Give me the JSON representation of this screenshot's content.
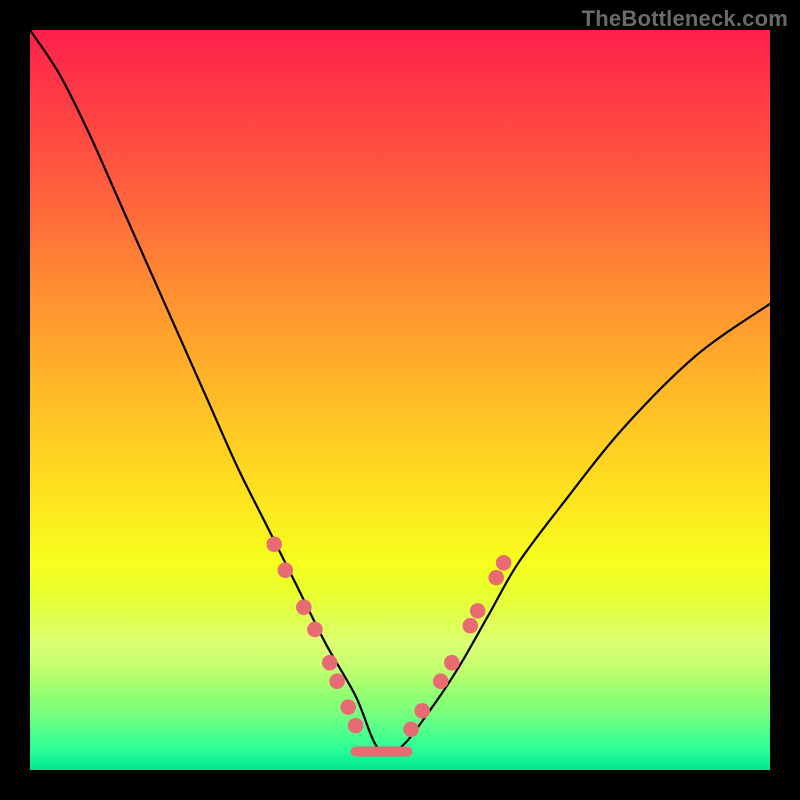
{
  "watermark": "TheBottleneck.com",
  "colors": {
    "frame": "#000000",
    "curve": "#000000",
    "bead": "#e86a73",
    "trough": "#e86a73",
    "gradient_stops": [
      {
        "pct": 0,
        "hex": "#ff1f4a"
      },
      {
        "pct": 6,
        "hex": "#ff3247"
      },
      {
        "pct": 20,
        "hex": "#ff5a3e"
      },
      {
        "pct": 34,
        "hex": "#ff8a33"
      },
      {
        "pct": 48,
        "hex": "#ffb728"
      },
      {
        "pct": 62,
        "hex": "#ffe01e"
      },
      {
        "pct": 72,
        "hex": "#f7ff1e"
      },
      {
        "pct": 80,
        "hex": "#d9ff3a"
      },
      {
        "pct": 86,
        "hex": "#b6ff5c"
      },
      {
        "pct": 92,
        "hex": "#7cff7c"
      },
      {
        "pct": 97,
        "hex": "#2dff97"
      },
      {
        "pct": 100,
        "hex": "#00e88f"
      }
    ]
  },
  "chart_data": {
    "type": "line",
    "title": "",
    "xlabel": "",
    "ylabel": "",
    "x_range": [
      0,
      100
    ],
    "y_range": [
      0,
      100
    ],
    "note": "Axes unlabeled; values are percent of plot area. y=100 at top, y=0 at bottom. Background encodes bottleneck severity by vertical position (red=high, green=low). Black line is bottleneck curve with minimum near x≈47. Coral beads/trough highlight near-zero-bottleneck region.",
    "series": [
      {
        "name": "bottleneck-curve",
        "x": [
          0,
          4,
          8,
          12,
          16,
          20,
          24,
          28,
          32,
          36,
          40,
          44,
          47,
          50,
          54,
          58,
          62,
          66,
          72,
          80,
          90,
          100
        ],
        "y": [
          100,
          94,
          86,
          77,
          68,
          59,
          50,
          41,
          33,
          25,
          17,
          10,
          3,
          3,
          8,
          14,
          21,
          28,
          36,
          46,
          56,
          63
        ]
      }
    ],
    "trough_segment": {
      "x_start": 44,
      "x_end": 51,
      "y": 2.5
    },
    "beads": [
      {
        "x": 33.0,
        "y": 30.5
      },
      {
        "x": 34.5,
        "y": 27.0
      },
      {
        "x": 37.0,
        "y": 22.0
      },
      {
        "x": 38.5,
        "y": 19.0
      },
      {
        "x": 40.5,
        "y": 14.5
      },
      {
        "x": 41.5,
        "y": 12.0
      },
      {
        "x": 43.0,
        "y": 8.5
      },
      {
        "x": 44.0,
        "y": 6.0
      },
      {
        "x": 51.5,
        "y": 5.5
      },
      {
        "x": 53.0,
        "y": 8.0
      },
      {
        "x": 55.5,
        "y": 12.0
      },
      {
        "x": 57.0,
        "y": 14.5
      },
      {
        "x": 59.5,
        "y": 19.5
      },
      {
        "x": 60.5,
        "y": 21.5
      },
      {
        "x": 63.0,
        "y": 26.0
      },
      {
        "x": 64.0,
        "y": 28.0
      }
    ]
  }
}
